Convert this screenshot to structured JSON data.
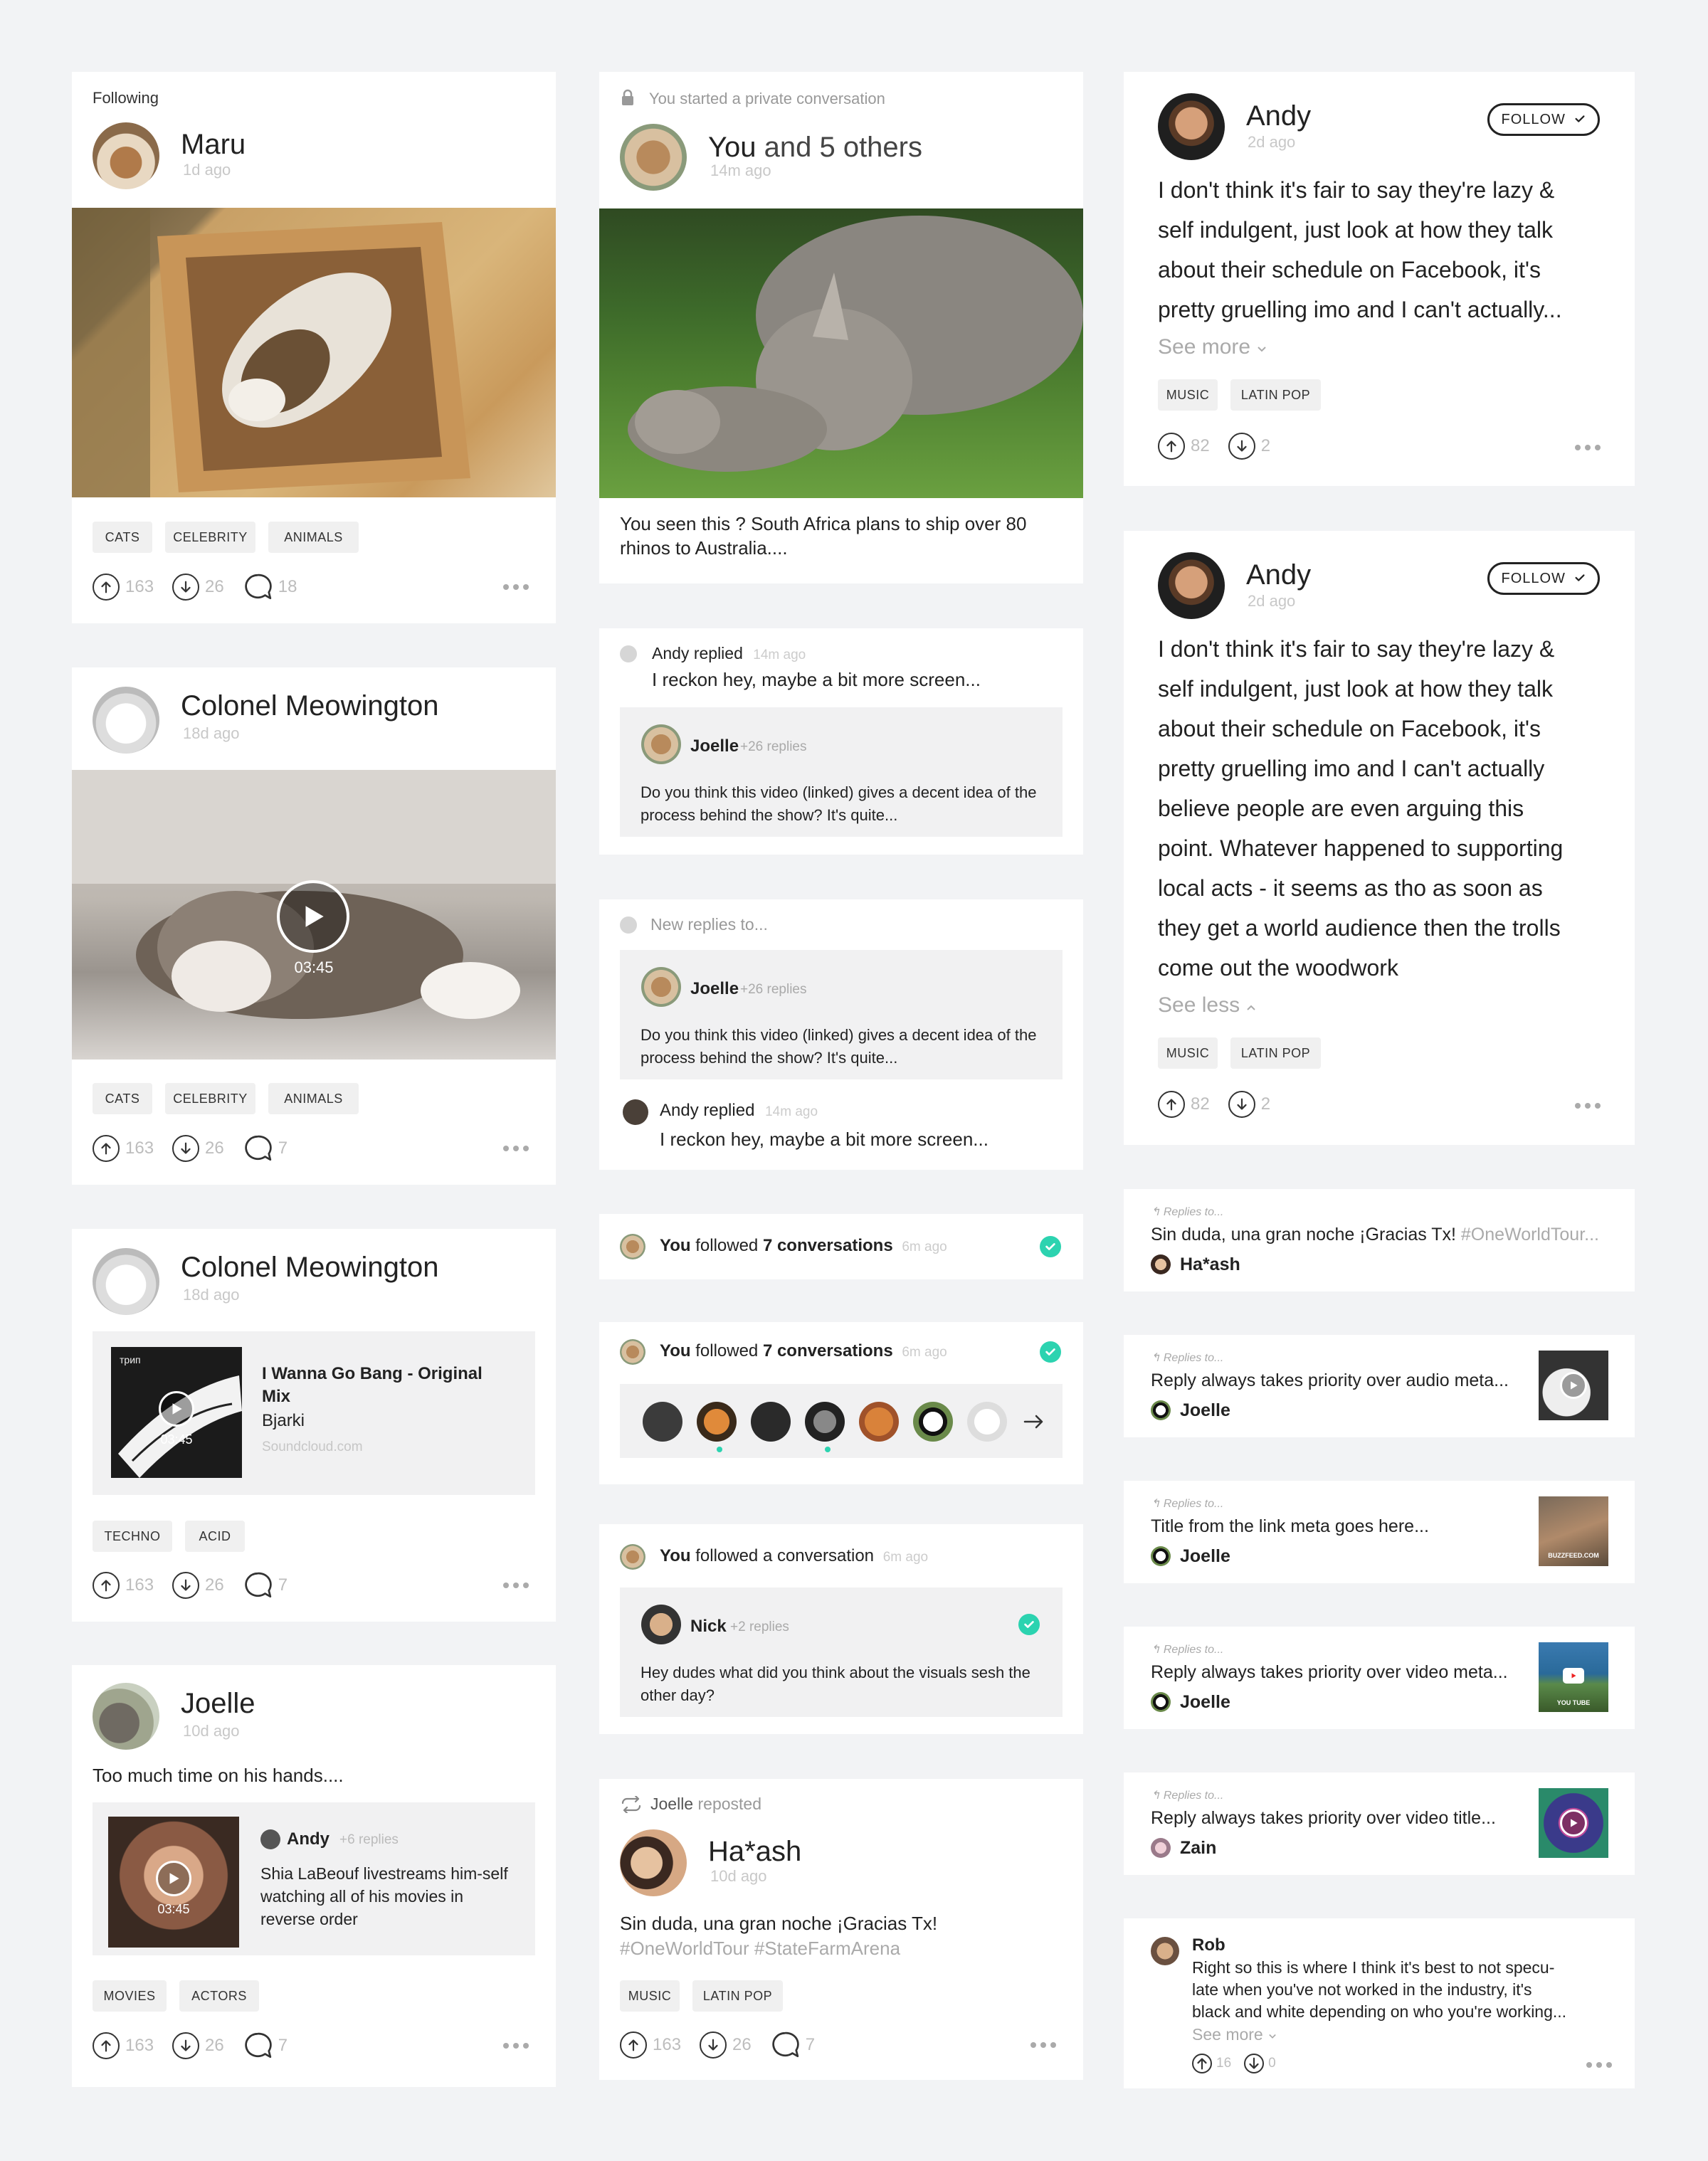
{
  "col1": {
    "c1": {
      "context": "Following",
      "name": "Maru",
      "time": "1d ago",
      "tags": [
        "CATS",
        "CELEBRITY",
        "ANIMALS"
      ],
      "up": "163",
      "down": "26",
      "comments": "18"
    },
    "c2": {
      "name": "Colonel Meowington",
      "time": "18d ago",
      "video_time": "03:45",
      "tags": [
        "CATS",
        "CELEBRITY",
        "ANIMALS"
      ],
      "up": "163",
      "down": "26",
      "comments": "7"
    },
    "c3": {
      "name": "Colonel Meowington",
      "time": "18d ago",
      "album_label": "трип",
      "track_title": "I Wanna Go Bang - Original Mix",
      "track_artist": "Bjarki",
      "track_source": "Soundcloud.com",
      "video_time": "03:45",
      "tags": [
        "TECHNO",
        "ACID"
      ],
      "up": "163",
      "down": "26",
      "comments": "7"
    },
    "c4": {
      "name": "Joelle",
      "time": "10d ago",
      "text": "Too much time on his hands....",
      "reply_name": "Andy",
      "reply_count": "+6 replies",
      "reply_text": "Shia LaBeouf livestreams him-self watching all of his movies in reverse order",
      "video_time": "03:45",
      "tags": [
        "MOVIES",
        "ACTORS"
      ],
      "up": "163",
      "down": "26",
      "comments": "7"
    }
  },
  "col2": {
    "c1": {
      "context": "You started a private conversation",
      "title_you": "You",
      "title_rest": " and 5 others",
      "time": "14m ago",
      "text": "You seen this ? South Africa plans to ship over 80 rhinos to Australia...."
    },
    "c2": {
      "reply_name": "Andy",
      "reply_word": " replied",
      "reply_time": "14m ago",
      "reply_text": "I reckon hey, maybe a bit more screen...",
      "quote_name": "Joelle",
      "quote_count": "+26 replies",
      "quote_text": "Do you think this video (linked) gives a decent idea of the process behind the show? It's quite..."
    },
    "c3": {
      "context": "New replies to...",
      "quote_name": "Joelle",
      "quote_count": "+26 replies",
      "quote_text": "Do you think this video (linked) gives a decent idea of the process behind the show? It's quite...",
      "reply_name": "Andy",
      "reply_word": " replied",
      "reply_time": "14m ago",
      "reply_text": "I reckon hey, maybe a bit more screen..."
    },
    "c4": {
      "you": "You",
      "word": " followed ",
      "bold": "7 conversations",
      "time": "6m ago"
    },
    "c5": {
      "you": "You",
      "word": " followed ",
      "bold": "7 conversations",
      "time": "6m ago"
    },
    "c6": {
      "you": "You",
      "word": " followed a conversation",
      "time": "6m ago",
      "quote_name": "Nick",
      "quote_count": "+2 replies",
      "quote_text": "Hey dudes what did you think about the visuals sesh the other day?"
    },
    "c7": {
      "repost_name": "Joelle",
      "repost_word": " reposted",
      "name": "Ha*ash",
      "time": "10d ago",
      "text": "Sin duda, una gran noche ¡Gracias Tx!",
      "hashtags": "#OneWorldTour #StateFarmArena",
      "tags": [
        "MUSIC",
        "LATIN POP"
      ],
      "up": "163",
      "down": "26",
      "comments": "7"
    }
  },
  "col3": {
    "c1": {
      "name": "Andy",
      "time": "2d ago",
      "follow": "FOLLOW",
      "lines": [
        "I don't think it's fair to say they're lazy &",
        "self indulgent, just look at how they talk",
        "about their schedule on Facebook, it's",
        "pretty gruelling imo and I can't actually..."
      ],
      "see": "See more",
      "tags": [
        "MUSIC",
        "LATIN POP"
      ],
      "up": "82",
      "down": "2"
    },
    "c2": {
      "name": "Andy",
      "time": "2d ago",
      "follow": "FOLLOW",
      "lines": [
        "I don't think it's fair to say they're lazy &",
        "self indulgent, just look at how they talk",
        "about their schedule on Facebook, it's",
        "pretty gruelling imo and I can't actually",
        "believe people are even arguing this",
        "point. Whatever happened to supporting",
        "local acts - it seems as tho as soon as",
        "they get a world audience then the trolls",
        "come out the woodwork"
      ],
      "see": "See less",
      "tags": [
        "MUSIC",
        "LATIN POP"
      ],
      "up": "82",
      "down": "2"
    },
    "r1": {
      "label": "Replies to...",
      "text": "Sin duda, una gran noche ¡Gracias Tx! ",
      "hash": "#OneWorldTour...",
      "user": "Ha*ash"
    },
    "r2": {
      "label": "Replies to...",
      "text": "Reply always takes priority over audio meta...",
      "user": "Joelle"
    },
    "r3": {
      "label": "Replies to...",
      "text": "Title from the link meta goes here...",
      "user": "Joelle",
      "thumb_label": "BUZZFEED.COM"
    },
    "r4": {
      "label": "Replies to...",
      "text": "Reply always takes priority over video meta...",
      "user": "Joelle",
      "thumb_label": "YOU TUBE"
    },
    "r5": {
      "label": "Replies to...",
      "text": "Reply always takes priority over video title...",
      "user": "Zain"
    },
    "r6": {
      "name": "Rob",
      "lines": [
        "Right so this is where I think it's best to not specu-",
        "late when you've not worked in the industry, it's",
        "black and white depending on who you're working..."
      ],
      "see": "See more",
      "up": "16",
      "down": "0"
    }
  }
}
